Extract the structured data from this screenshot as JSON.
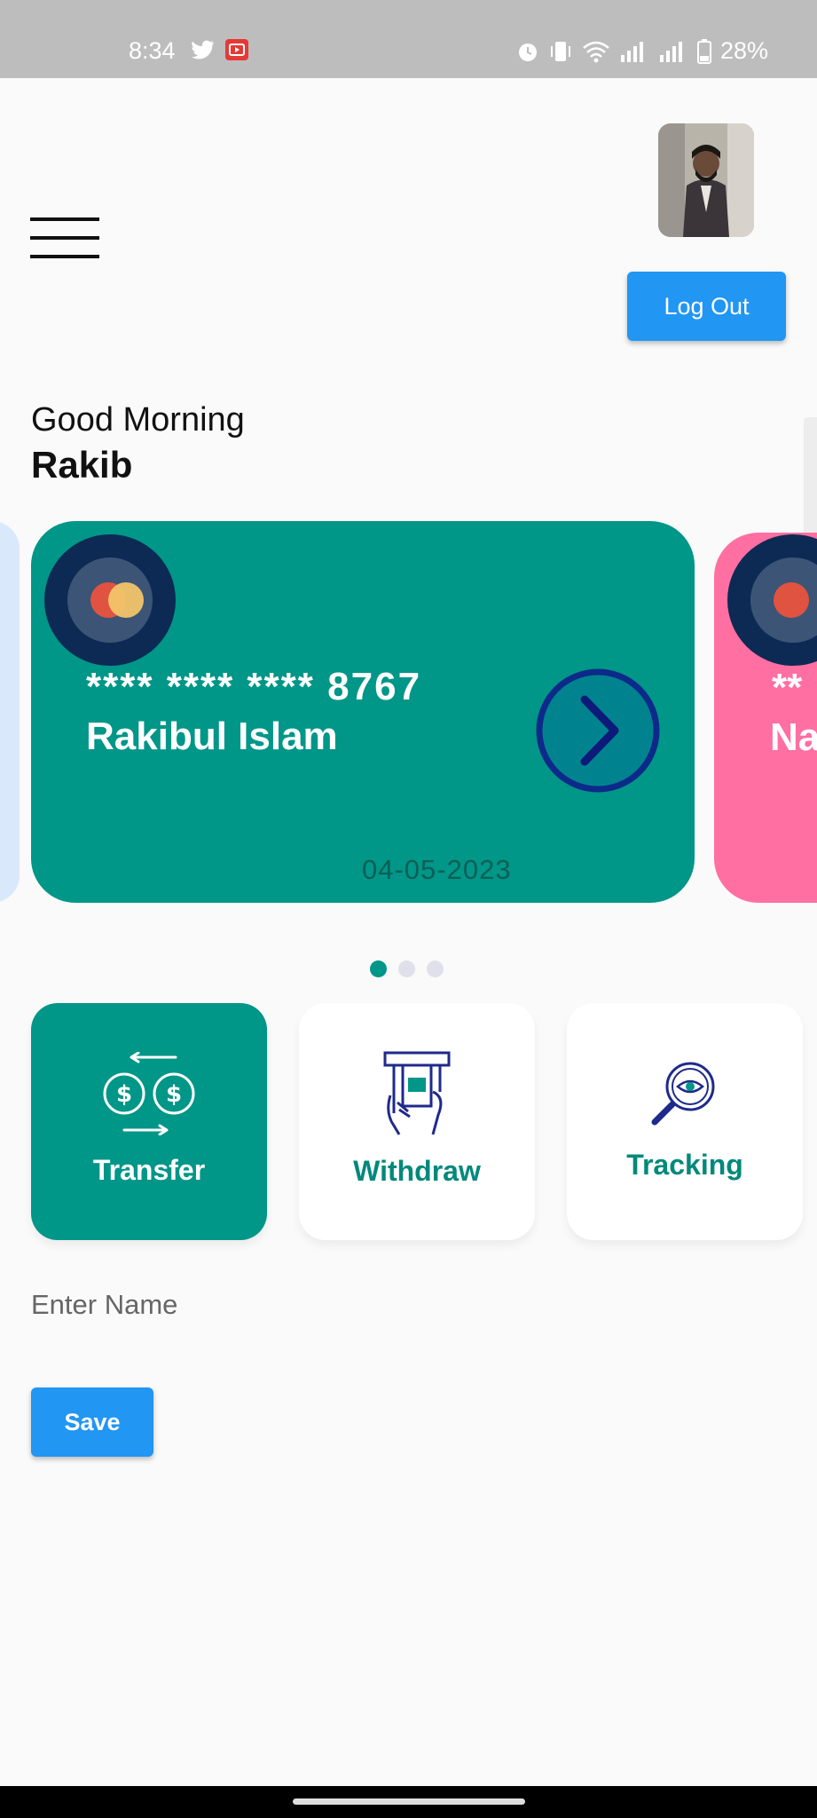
{
  "status_bar": {
    "time": "8:34",
    "battery": "28%",
    "icons": [
      "twitter-icon",
      "youtube-icon",
      "alarm-icon",
      "vibrate-icon",
      "wifi-icon",
      "signal-icon",
      "battery-icon"
    ]
  },
  "header": {
    "menu_icon": "hamburger-menu-icon",
    "logout_label": "Log Out"
  },
  "greeting": {
    "text": "Good Morning",
    "name": "Rakib"
  },
  "cards": [
    {
      "number": "**** **** **** 8767",
      "holder": "Rakibul Islam",
      "date": "04-05-2023",
      "color": "#009688"
    },
    {
      "number": "**",
      "holder": "Na",
      "color": "#ff6fa2"
    }
  ],
  "carousel": {
    "count": 3,
    "active": 0
  },
  "actions": [
    {
      "label": "Transfer",
      "icon": "transfer-icon",
      "active": true
    },
    {
      "label": "Withdraw",
      "icon": "atm-withdraw-icon",
      "active": false
    },
    {
      "label": "Tracking",
      "icon": "tracking-search-icon",
      "active": false
    }
  ],
  "form": {
    "name_placeholder": "Enter Name",
    "save_label": "Save"
  },
  "colors": {
    "primary": "#009688",
    "button_blue": "#2196f3",
    "icon_navy": "#1f2a8c",
    "pink_card": "#ff6fa2"
  }
}
